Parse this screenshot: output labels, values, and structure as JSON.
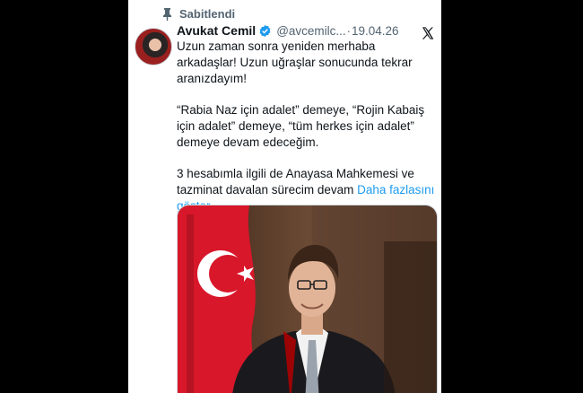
{
  "pinned_label": "Sabitlendi",
  "author": {
    "name": "Avukat Cemil",
    "handle": "@avcemilc...",
    "separator": "·",
    "date": "19.04.26"
  },
  "body": {
    "line1": "Uzun zaman sonra yeniden merhaba arkadaşlar! Uzun uğraşlar sonucunda tekrar aranızdayım!",
    "line2": "“Rabia Naz için adalet” demeye, “Rojin Kabaiş için adalet” demeye, “tüm herkes için adalet” demeye devam edeceğim.",
    "line3": "3 hesabımla ilgili de Anayasa Mahkemesi ve tazminat davalan sürecim devam",
    "show_more": "Daha fazlasını göster"
  },
  "colors": {
    "link": "#1d9bf0",
    "verified": "#1d9bf0",
    "flag_red": "#d8172a"
  },
  "icons": {
    "pin": "pin-icon",
    "verified": "verified-badge-icon",
    "platform": "x-logo-icon"
  }
}
